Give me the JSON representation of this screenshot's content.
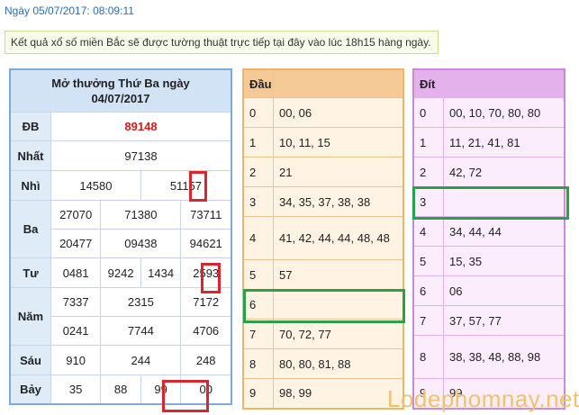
{
  "date_line": "Ngày 05/07/2017: 08:09:11",
  "notice": "Kết quả xổ số miền Bắc sẽ được tường thuật trực tiếp tại đây vào lúc 18h15 hàng ngày.",
  "results": {
    "header_line1": "Mở thưởng Thứ Ba ngày",
    "header_line2": "04/07/2017",
    "db_label": "ĐB",
    "db": "89148",
    "nhat_label": "Nhất",
    "nhat": "97138",
    "nhi_label": "Nhì",
    "nhi": [
      "14580",
      "51157"
    ],
    "ba_label": "Ba",
    "ba": [
      "27070",
      "71380",
      "73711",
      "20477",
      "09438",
      "94621"
    ],
    "tu_label": "Tư",
    "tu": [
      "0481",
      "9242",
      "1434",
      "2593"
    ],
    "nam_label": "Năm",
    "nam": [
      "7337",
      "2315",
      "7172",
      "0241",
      "7744",
      "4706"
    ],
    "sau_label": "Sáu",
    "sau": [
      "910",
      "244",
      "248"
    ],
    "bay_label": "Bảy",
    "bay": [
      "35",
      "88",
      "99",
      "00"
    ]
  },
  "dau": {
    "header": "Đầu",
    "rows": [
      {
        "k": "0",
        "v": "00, 06"
      },
      {
        "k": "1",
        "v": "10, 11, 15"
      },
      {
        "k": "2",
        "v": "21"
      },
      {
        "k": "3",
        "v": "34, 35, 37, 38, 38"
      },
      {
        "k": "4",
        "v": "41, 42, 44, 44, 48, 48"
      },
      {
        "k": "5",
        "v": "57"
      },
      {
        "k": "6",
        "v": ""
      },
      {
        "k": "7",
        "v": "70, 72, 77"
      },
      {
        "k": "8",
        "v": "80, 80, 81, 88"
      },
      {
        "k": "9",
        "v": "98, 99"
      }
    ]
  },
  "dit": {
    "header": "Đít",
    "rows": [
      {
        "k": "0",
        "v": "00, 10, 70, 80, 80"
      },
      {
        "k": "1",
        "v": "11, 21, 41, 81"
      },
      {
        "k": "2",
        "v": "42, 72"
      },
      {
        "k": "3",
        "v": ""
      },
      {
        "k": "4",
        "v": "34, 44, 44"
      },
      {
        "k": "5",
        "v": "15, 35"
      },
      {
        "k": "6",
        "v": "06"
      },
      {
        "k": "7",
        "v": "37, 57, 77"
      },
      {
        "k": "8",
        "v": "38, 38, 48, 88, 98"
      },
      {
        "k": "9",
        "v": "99"
      }
    ]
  },
  "watermark": "Lodephomnay.net",
  "colors": {
    "red_box": "#d6262e",
    "green_box": "#2aa04a",
    "db_red": "#d21a1a"
  }
}
